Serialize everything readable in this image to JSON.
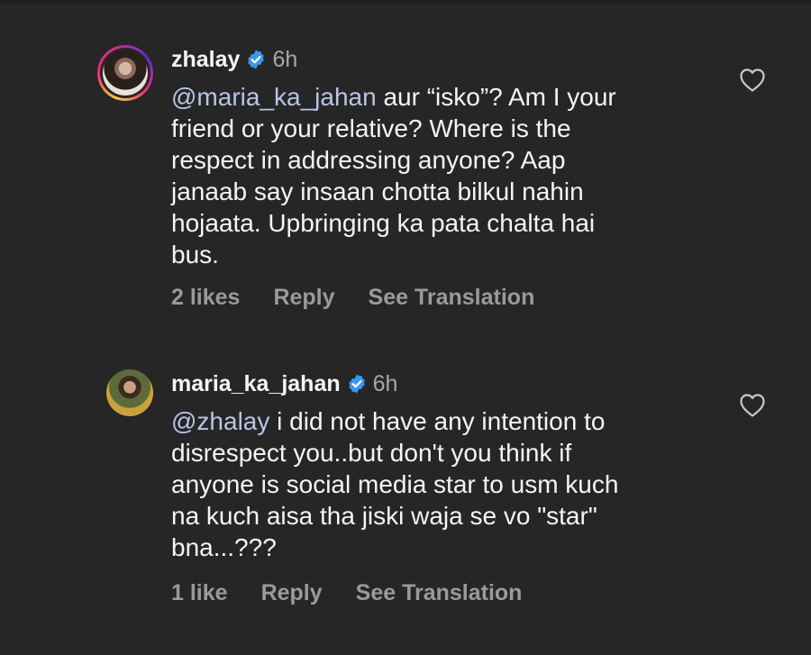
{
  "comments": [
    {
      "username": "zhalay",
      "time": "6h",
      "mention": "@maria_ka_jahan",
      "text": " aur “isko”? Am I your\nfriend or your relative? Where is the\nrespect in addressing anyone? Aap\njanaab say insaan chotta bilkul nahin\nhojaata. Upbringing ka pata chalta hai\nbus.",
      "likes": "2 likes",
      "reply": "Reply",
      "translate": "See Translation",
      "has_story_ring": true
    },
    {
      "username": "maria_ka_jahan",
      "time": "6h",
      "mention": "@zhalay",
      "text": " i did not have any intention to\ndisrespect you..but don't you think if\nanyone is social media star to usm kuch\nna kuch aisa tha jiski waja se vo \"star\"\nbna...???",
      "likes": "1 like",
      "reply": "Reply",
      "translate": "See Translation",
      "has_story_ring": false
    }
  ],
  "colors": {
    "background": "#262626",
    "mention": "#b9c5e6",
    "verified": "#3897f0",
    "muted": "#9a9a9a"
  },
  "icons": {
    "verified": "verified-badge-icon",
    "like": "heart-outline-icon"
  }
}
